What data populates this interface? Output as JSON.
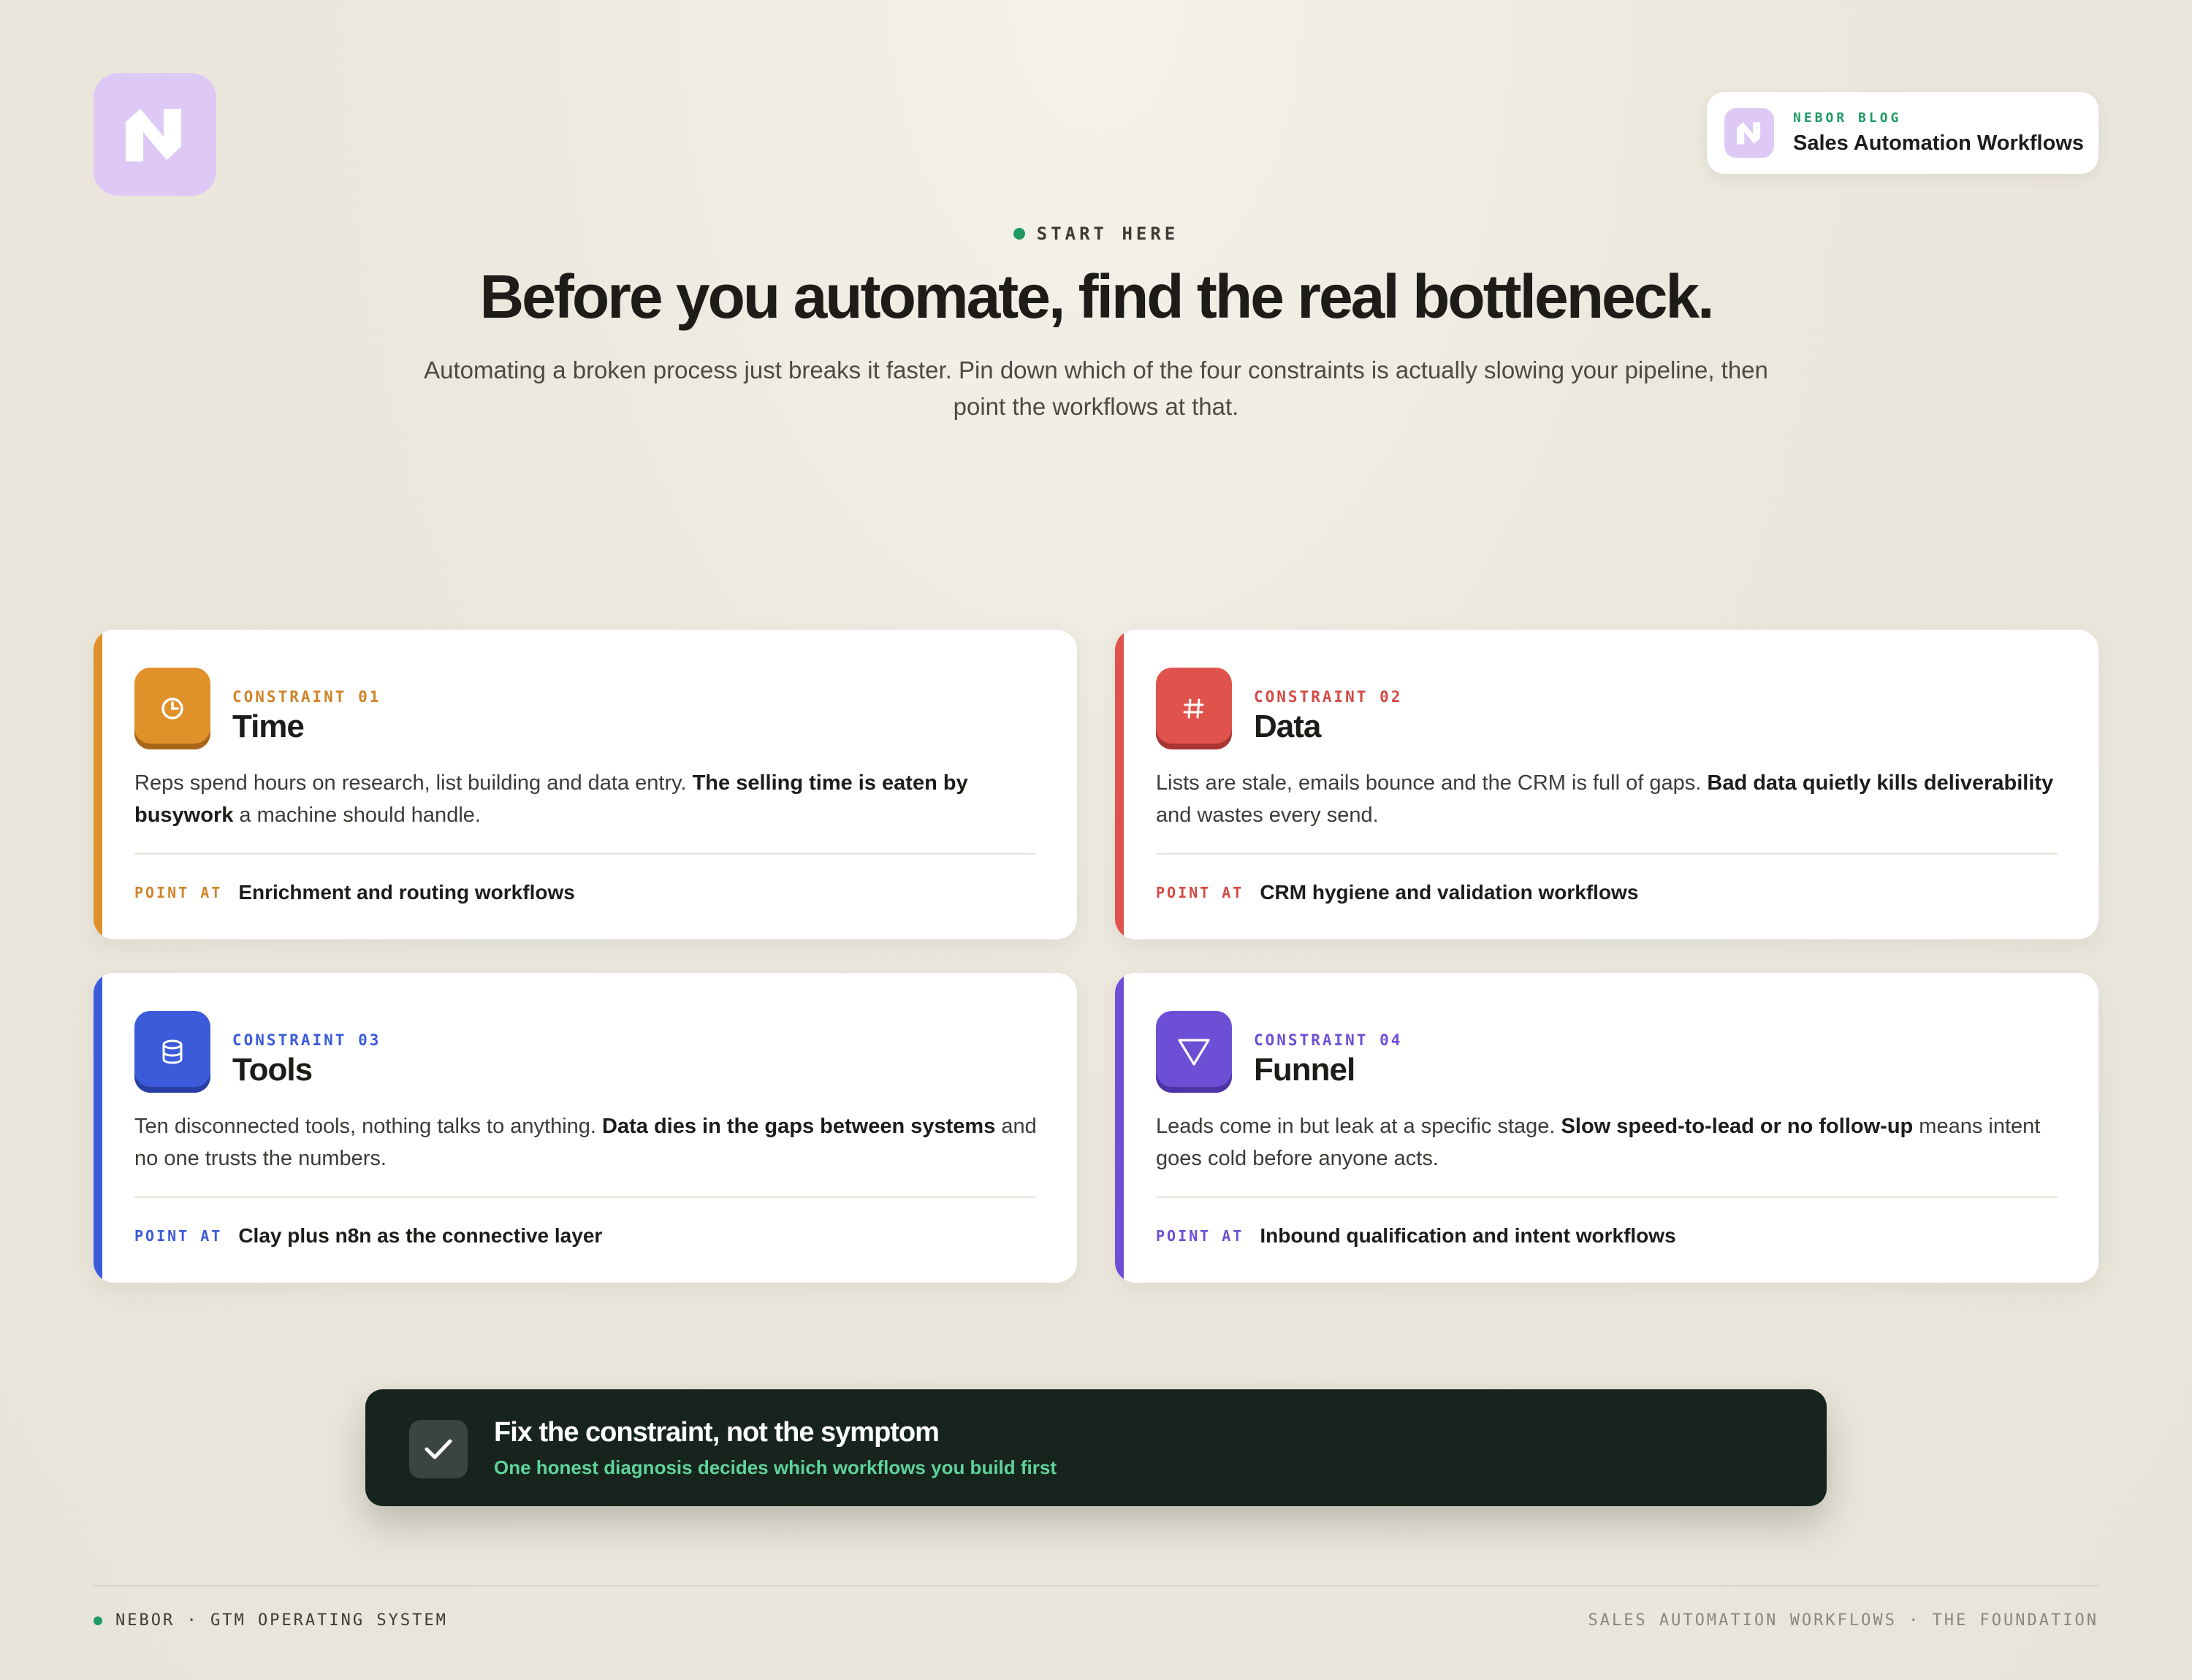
{
  "brand": {
    "logo_icon": "nebor-logo-icon",
    "accent_color": "#dec9f6"
  },
  "blog_badge": {
    "kicker": "NEBOR BLOG",
    "title": "Sales Automation Workflows"
  },
  "hero": {
    "kicker": "START HERE",
    "headline": "Before you automate, find the real bottleneck.",
    "subtitle": "Automating a broken process just breaks it faster. Pin down which of the four constraints is actually slowing your pipeline, then point the workflows at that."
  },
  "constraints": [
    {
      "kicker": "CONSTRAINT 01",
      "title": "Time",
      "icon": "clock-icon",
      "color": "#e0912a",
      "body_plain": "Reps spend hours on research, list building and data entry. ",
      "body_bold": "The selling time is eaten by busywork",
      "body_tail": " a machine should handle.",
      "point_label": "POINT AT",
      "point_text": "Enrichment and routing workflows"
    },
    {
      "kicker": "CONSTRAINT 02",
      "title": "Data",
      "icon": "hash-icon",
      "color": "#e0534d",
      "body_plain": "Lists are stale, emails bounce and the CRM is full of gaps. ",
      "body_bold": "Bad data quietly kills deliverability",
      "body_tail": " and wastes every send.",
      "point_label": "POINT AT",
      "point_text": "CRM hygiene and validation workflows"
    },
    {
      "kicker": "CONSTRAINT 03",
      "title": "Tools",
      "icon": "database-icon",
      "color": "#3b5bdb",
      "body_plain": "Ten disconnected tools, nothing talks to anything. ",
      "body_bold": "Data dies in the gaps between systems",
      "body_tail": " and no one trusts the numbers.",
      "point_label": "POINT AT",
      "point_text": "Clay plus n8n as the connective layer"
    },
    {
      "kicker": "CONSTRAINT 04",
      "title": "Funnel",
      "icon": "funnel-icon",
      "color": "#6d4fd6",
      "body_plain": "Leads come in but leak at a specific stage. ",
      "body_bold": "Slow speed-to-lead or no follow-up",
      "body_tail": " means intent goes cold before anyone acts.",
      "point_label": "POINT AT",
      "point_text": "Inbound qualification and intent workflows"
    }
  ],
  "banner": {
    "title": "Fix the constraint, not the symptom",
    "subtitle": "One honest diagnosis decides which workflows you build first",
    "icon": "check-icon"
  },
  "footer": {
    "left": "NEBOR · GTM OPERATING SYSTEM",
    "right": "SALES AUTOMATION WORKFLOWS · THE FOUNDATION"
  }
}
